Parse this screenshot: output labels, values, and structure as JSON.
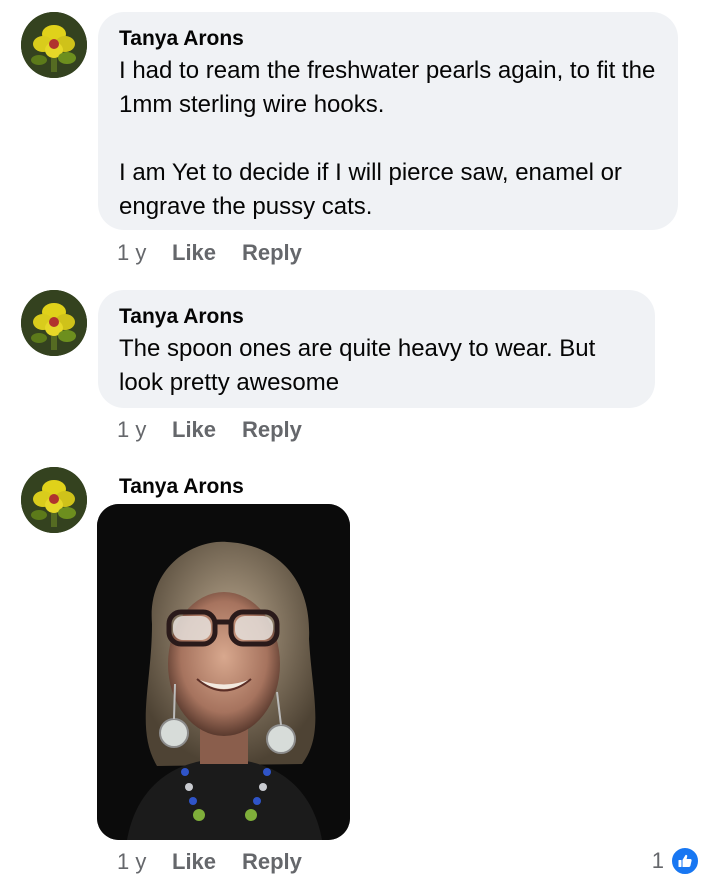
{
  "comments": [
    {
      "author": "Tanya Arons",
      "paragraphs": [
        "I had to ream the freshwater pearls again, to fit the 1mm sterling wire hooks.",
        "I am Yet to decide if I will pierce saw, enamel or engrave the pussy cats."
      ],
      "age": "1 y",
      "like_label": "Like",
      "reply_label": "Reply"
    },
    {
      "author": "Tanya Arons",
      "paragraphs": [
        "The spoon ones are quite heavy to wear.  But look pretty awesome"
      ],
      "age": "1 y",
      "like_label": "Like",
      "reply_label": "Reply"
    },
    {
      "author": "Tanya Arons",
      "age": "1 y",
      "like_label": "Like",
      "reply_label": "Reply",
      "reaction_count": "1",
      "reaction_icon": "thumbs-up-icon"
    }
  ],
  "colors": {
    "bubble": "#f0f2f5",
    "secondary_text": "#65676b",
    "like_blue": "#1877f2"
  }
}
